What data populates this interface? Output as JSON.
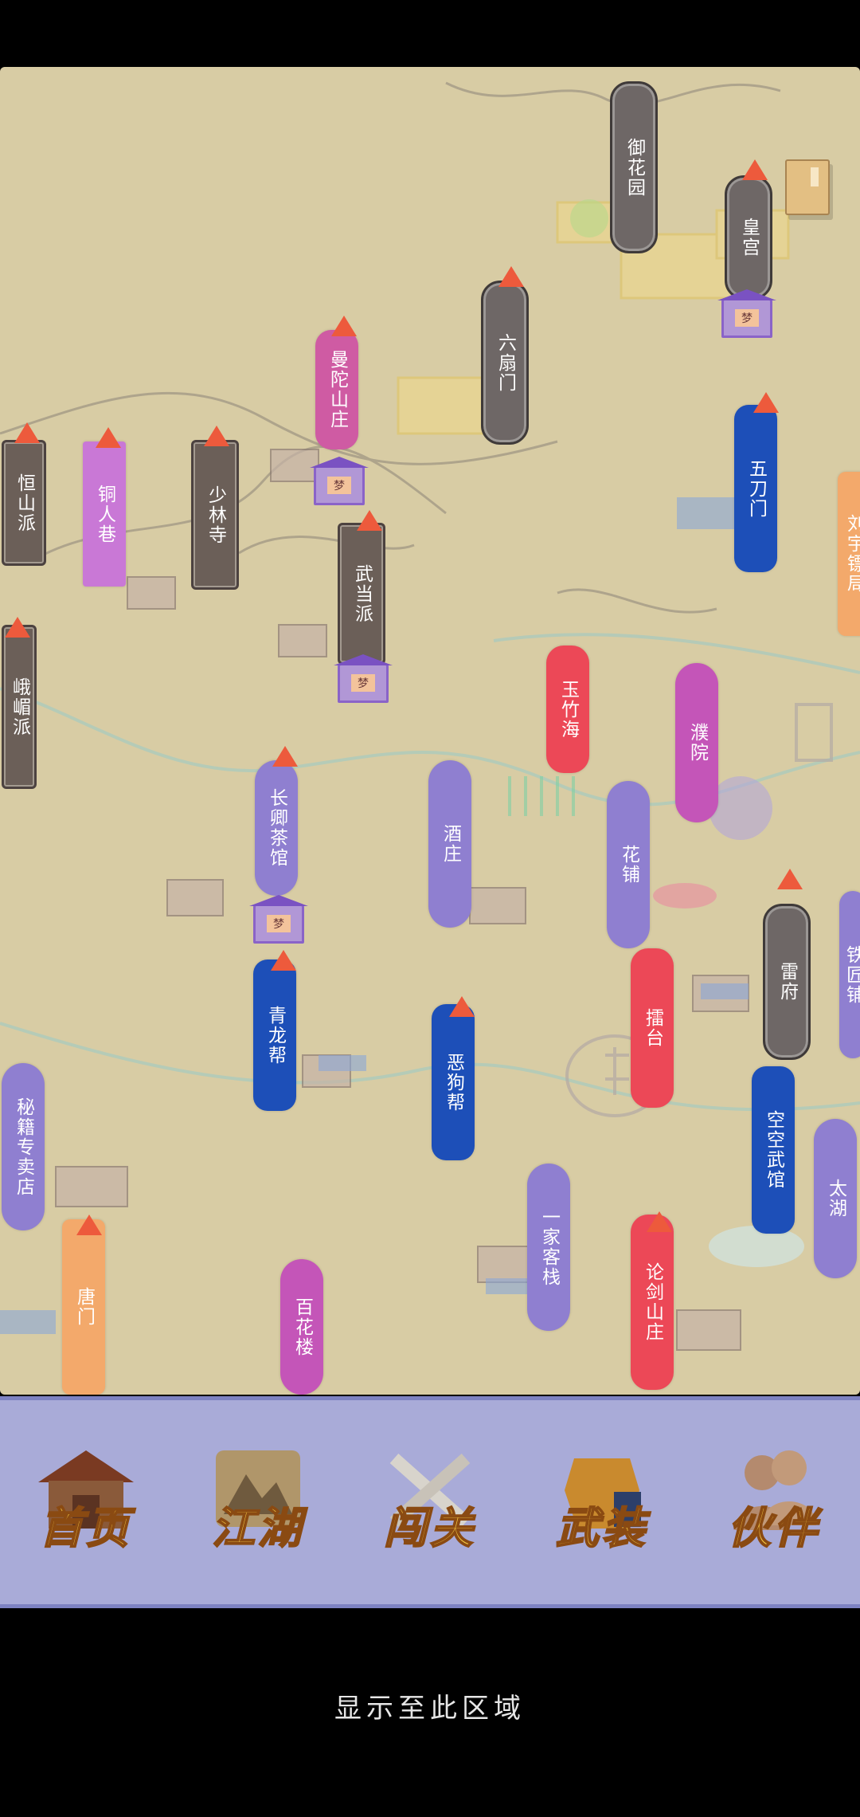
{
  "map": {
    "locations": [
      {
        "id": "yuhuayuan",
        "label": "御花园",
        "style": "ornate"
      },
      {
        "id": "huanggong",
        "label": "皇宫",
        "style": "ornate"
      },
      {
        "id": "liushanmen",
        "label": "六扇门",
        "style": "ornate"
      },
      {
        "id": "mantuo",
        "label": "曼陀山庄",
        "style": "pink"
      },
      {
        "id": "wudaomen",
        "label": "五刀门",
        "style": "blue"
      },
      {
        "id": "hengshan",
        "label": "恒山派",
        "style": "dark"
      },
      {
        "id": "tongrenxiang",
        "label": "铜人巷",
        "style": "lilac"
      },
      {
        "id": "shaolin",
        "label": "少林寺",
        "style": "dark"
      },
      {
        "id": "wudang",
        "label": "武当派",
        "style": "dark"
      },
      {
        "id": "right_edge_orange",
        "label": "刘宇镖局",
        "style": "orange"
      },
      {
        "id": "emei",
        "label": "峨嵋派",
        "style": "dark"
      },
      {
        "id": "yuzhuhai",
        "label": "玉竹海",
        "style": "red"
      },
      {
        "id": "puyuan",
        "label": "濮院",
        "style": "magenta"
      },
      {
        "id": "jiuzhuang",
        "label": "酒庄",
        "style": "purple"
      },
      {
        "id": "huapu",
        "label": "花铺",
        "style": "purple"
      },
      {
        "id": "changqing",
        "label": "长卿茶馆",
        "style": "purple"
      },
      {
        "id": "leifu",
        "label": "雷府",
        "style": "ornate"
      },
      {
        "id": "right_edge_purple",
        "label": "铁匠铺",
        "style": "purple"
      },
      {
        "id": "leitai",
        "label": "擂台",
        "style": "red"
      },
      {
        "id": "qinglong",
        "label": "青龙帮",
        "style": "blue"
      },
      {
        "id": "egou",
        "label": "恶狗帮",
        "style": "blue"
      },
      {
        "id": "miji",
        "label": "秘籍专卖店",
        "style": "purple"
      },
      {
        "id": "kongkong",
        "label": "空空武馆",
        "style": "blue"
      },
      {
        "id": "taihu",
        "label": "太湖",
        "style": "purple"
      },
      {
        "id": "yijia",
        "label": "一家客栈",
        "style": "purple"
      },
      {
        "id": "lunjian",
        "label": "论剑山庄",
        "style": "red"
      },
      {
        "id": "tangmen",
        "label": "唐门",
        "style": "orange"
      },
      {
        "id": "baihualou",
        "label": "百花楼",
        "style": "magenta"
      }
    ],
    "pavilion_mark": "梦",
    "book_icon": "book-icon"
  },
  "nav": {
    "items": [
      {
        "label": "首页",
        "icon": "house-icon"
      },
      {
        "label": "江湖",
        "icon": "scroll-map-icon"
      },
      {
        "label": "闯关",
        "icon": "crossed-swords-icon"
      },
      {
        "label": "武装",
        "icon": "armor-icon"
      },
      {
        "label": "伙伴",
        "icon": "companions-icon"
      }
    ]
  },
  "footer": {
    "note": "显示至此区域"
  },
  "colors": {
    "map_bg": "#d8cca4",
    "navbar_bg": "#a9abd8",
    "flag": "#ed5a3c",
    "nav_text": "#f1c443"
  }
}
